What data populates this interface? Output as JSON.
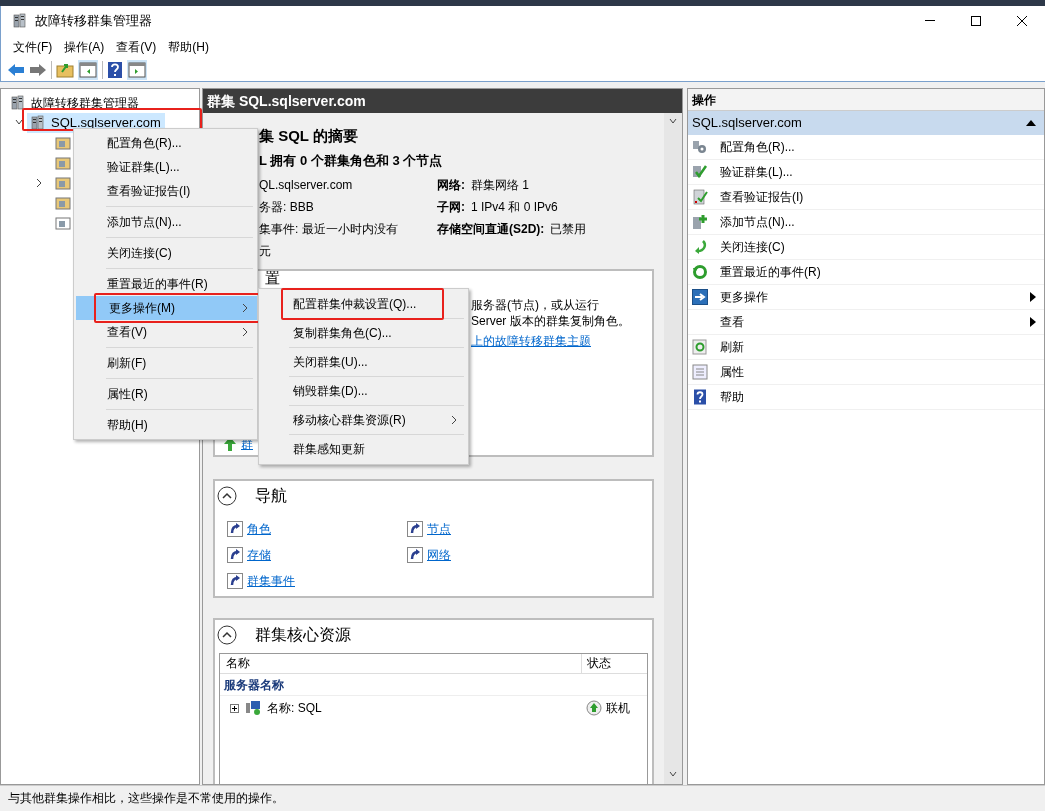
{
  "window": {
    "title": "故障转移群集管理器"
  },
  "menu_bar": [
    "文件(F)",
    "操作(A)",
    "查看(V)",
    "帮助(H)"
  ],
  "tree": {
    "root": "故障转移群集管理器",
    "cluster": {
      "label": "SQL.sqlserver.com",
      "selected": true,
      "expanded": true,
      "annotated": true
    },
    "children": [
      {
        "expandable": false
      },
      {
        "expandable": false
      },
      {
        "expandable": true
      },
      {
        "expandable": false
      },
      {
        "expandable": false
      }
    ]
  },
  "content": {
    "header": "群集 SQL.sqlserver.com",
    "summary_title": "集 SQL 的摘要",
    "summary_subtitle": "L 拥有 0 个群集角色和 3 个节点",
    "details_left": [
      "QL.sqlserver.com",
      "务器: BBB",
      "集事件: 最近一小时内没有",
      "元"
    ],
    "details_right": [
      {
        "label": "网络:",
        "value": "群集网络 1"
      },
      {
        "label": "子网:",
        "value": "1 IPv4 和 0 IPv6"
      },
      {
        "label": "存储空间直通(S2D):",
        "value": "已禁用"
      }
    ],
    "configure": {
      "heading": "置",
      "lines": [
        "服务器(节点)，或从运行",
        "Server 版本的群集复制角色。"
      ],
      "link": "上的故障转移群集主题",
      "action_link": "群"
    },
    "navigation": {
      "title": "导航",
      "links": [
        "角色",
        "节点",
        "存储",
        "网络",
        "群集事件"
      ]
    },
    "core_resources": {
      "title": "群集核心资源",
      "columns": [
        "名称",
        "状态"
      ],
      "group": "服务器名称",
      "rows": [
        {
          "name": "名称: SQL",
          "status": "联机"
        }
      ]
    }
  },
  "actions": {
    "title": "操作",
    "section": "SQL.sqlserver.com",
    "expanded": true,
    "items": [
      {
        "label": "配置角色(R)...",
        "submenu": false
      },
      {
        "label": "验证群集(L)...",
        "submenu": false
      },
      {
        "label": "查看验证报告(I)",
        "submenu": false
      },
      {
        "label": "添加节点(N)...",
        "submenu": false
      },
      {
        "label": "关闭连接(C)",
        "submenu": false
      },
      {
        "label": "重置最近的事件(R)",
        "submenu": false
      },
      {
        "label": "更多操作",
        "submenu": true
      },
      {
        "label": "查看",
        "submenu": true
      },
      {
        "label": "刷新",
        "submenu": false
      },
      {
        "label": "属性",
        "submenu": false
      },
      {
        "label": "帮助",
        "submenu": false
      }
    ]
  },
  "context_menu": [
    {
      "kind": "item",
      "label": "配置角色(R)...",
      "submenu": false,
      "selected": false,
      "annotated": false
    },
    {
      "kind": "item",
      "label": "验证群集(L)...",
      "submenu": false,
      "selected": false,
      "annotated": false
    },
    {
      "kind": "item",
      "label": "查看验证报告(I)",
      "submenu": false,
      "selected": false,
      "annotated": false
    },
    {
      "kind": "separator"
    },
    {
      "kind": "item",
      "label": "添加节点(N)...",
      "submenu": false,
      "selected": false,
      "annotated": false
    },
    {
      "kind": "separator"
    },
    {
      "kind": "item",
      "label": "关闭连接(C)",
      "submenu": false,
      "selected": false,
      "annotated": false
    },
    {
      "kind": "separator"
    },
    {
      "kind": "item",
      "label": "重置最近的事件(R)",
      "submenu": false,
      "selected": false,
      "annotated": false
    },
    {
      "kind": "item",
      "label": "更多操作(M)",
      "submenu": true,
      "selected": true,
      "annotated": true
    },
    {
      "kind": "item",
      "label": "查看(V)",
      "submenu": true,
      "selected": false,
      "annotated": false
    },
    {
      "kind": "separator"
    },
    {
      "kind": "item",
      "label": "刷新(F)",
      "submenu": false,
      "selected": false,
      "annotated": false
    },
    {
      "kind": "separator"
    },
    {
      "kind": "item",
      "label": "属性(R)",
      "submenu": false,
      "selected": false,
      "annotated": false
    },
    {
      "kind": "separator"
    },
    {
      "kind": "item",
      "label": "帮助(H)",
      "submenu": false,
      "selected": false,
      "annotated": false
    }
  ],
  "submenu": [
    {
      "kind": "item",
      "label": "配置群集仲裁设置(Q)...",
      "submenu": false,
      "annotated": true
    },
    {
      "kind": "separator"
    },
    {
      "kind": "item",
      "label": "复制群集角色(C)...",
      "submenu": false,
      "annotated": false
    },
    {
      "kind": "separator"
    },
    {
      "kind": "item",
      "label": "关闭群集(U)...",
      "submenu": false,
      "annotated": false
    },
    {
      "kind": "separator"
    },
    {
      "kind": "item",
      "label": "销毁群集(D)...",
      "submenu": false,
      "annotated": false
    },
    {
      "kind": "separator"
    },
    {
      "kind": "item",
      "label": "移动核心群集资源(R)",
      "submenu": true,
      "annotated": false
    },
    {
      "kind": "separator"
    },
    {
      "kind": "item",
      "label": "群集感知更新",
      "submenu": false,
      "annotated": false
    }
  ],
  "status_bar": "与其他群集操作相比，这些操作是不常使用的操作。"
}
